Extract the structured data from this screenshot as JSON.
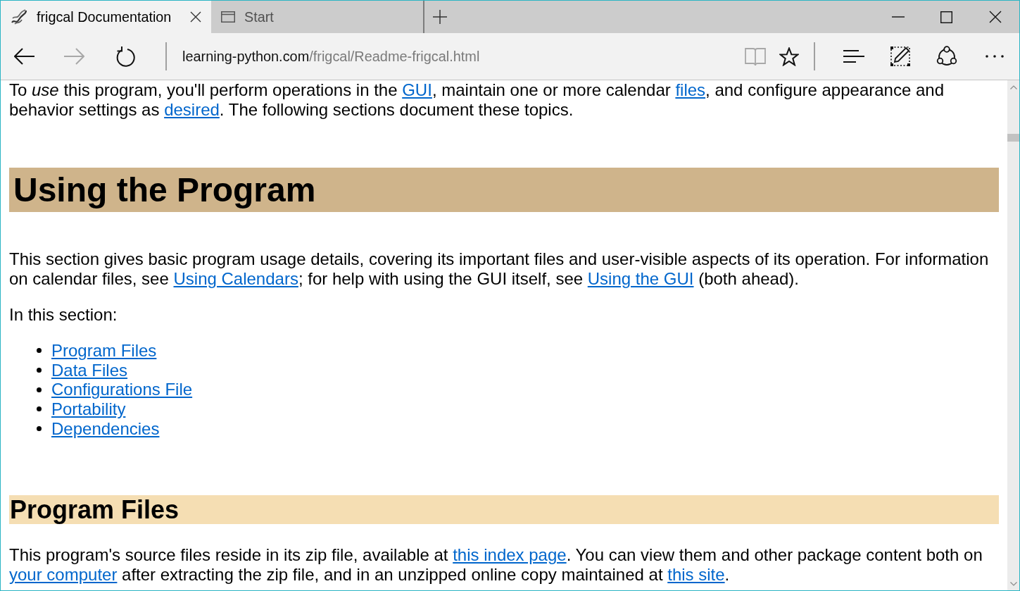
{
  "window": {
    "tabs": [
      {
        "kind": "site",
        "title": "frigcal Documentation",
        "selected": true
      },
      {
        "kind": "start",
        "title": "Start",
        "selected": false
      }
    ]
  },
  "toolbar": {
    "nav_buttons": [
      {
        "kind": "back",
        "disabled": false
      },
      {
        "kind": "forward",
        "disabled": true
      },
      {
        "kind": "refresh",
        "disabled": false
      }
    ],
    "address": {
      "host": "learning-python.com",
      "path": "/frigcal/Readme-frigcal.html"
    },
    "page_buttons": [
      {
        "kind": "reading-view",
        "disabled": true
      },
      {
        "kind": "favorite",
        "disabled": false
      }
    ],
    "tool_buttons": [
      {
        "kind": "hub"
      },
      {
        "kind": "web-note"
      },
      {
        "kind": "share"
      },
      {
        "kind": "more"
      }
    ]
  },
  "page": {
    "blocks": [
      {
        "kind": "paragraph",
        "parts": [
          {
            "kind": "text",
            "text": "To *use* this program, you'll perform operations in the "
          },
          {
            "kind": "link",
            "text": "GUI"
          },
          {
            "kind": "text",
            "text": ", maintain one or more calendar "
          },
          {
            "kind": "link",
            "text": "files"
          },
          {
            "kind": "text",
            "text": ", and configure appearance and behavior settings as "
          },
          {
            "kind": "link",
            "text": "desired"
          },
          {
            "kind": "text",
            "text": ". The following sections document these topics."
          }
        ]
      },
      {
        "kind": "heading1",
        "text": "Using the Program"
      },
      {
        "kind": "paragraph",
        "parts": [
          {
            "kind": "text",
            "text": "This section gives basic program usage details, covering its important files and user-visible aspects of its operation. For information on calendar files, see "
          },
          {
            "kind": "link",
            "text": "Using Calendars"
          },
          {
            "kind": "text",
            "text": "; for help with using the GUI itself, see "
          },
          {
            "kind": "link",
            "text": "Using the GUI"
          },
          {
            "kind": "text",
            "text": " (both ahead)."
          }
        ]
      },
      {
        "kind": "paragraph",
        "parts": [
          {
            "kind": "text",
            "text": "In this section:"
          }
        ]
      },
      {
        "kind": "list",
        "items": [
          "Program Files",
          "Data Files",
          "Configurations File",
          "Portability",
          "Dependencies"
        ]
      },
      {
        "kind": "heading2",
        "text": "Program Files"
      },
      {
        "kind": "paragraph",
        "parts": [
          {
            "kind": "text",
            "text": "This program's source files reside in its zip file, available at "
          },
          {
            "kind": "link",
            "text": "this index page"
          },
          {
            "kind": "text",
            "text": ". You can view them and other package content both on "
          },
          {
            "kind": "link",
            "text": "your computer"
          },
          {
            "kind": "text",
            "text": " after extracting the zip file, and in an unzipped online copy maintained at "
          },
          {
            "kind": "link",
            "text": "this site"
          },
          {
            "kind": "text",
            "text": "."
          }
        ]
      }
    ]
  }
}
